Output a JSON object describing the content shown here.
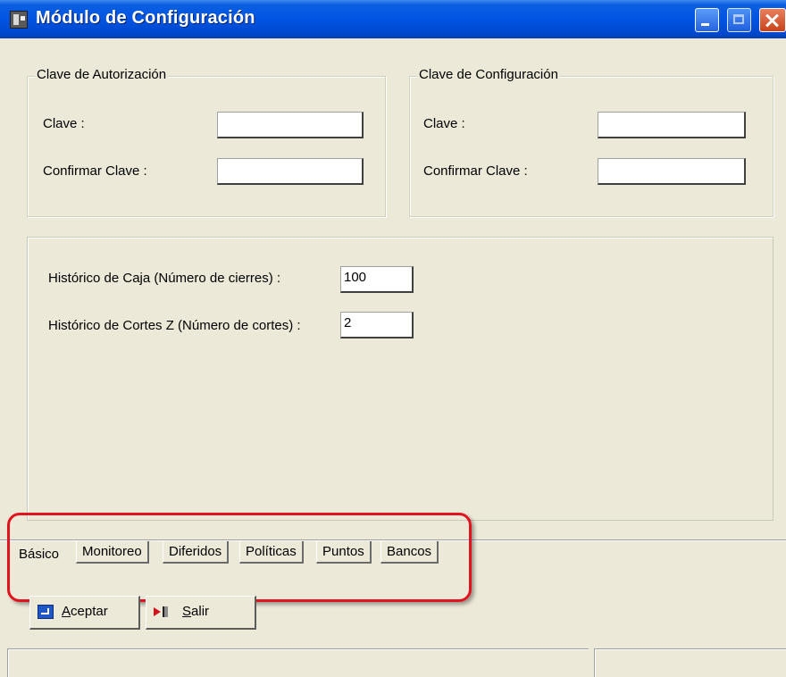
{
  "window": {
    "title": "Módulo de Configuración",
    "colors": {
      "title_bar": "#0054e3",
      "close_button": "#d44a24",
      "highlight": "#e0141e",
      "background": "#ece9d8"
    }
  },
  "authorization_group": {
    "legend": "Clave de Autorización",
    "key_label": "Clave :",
    "key_value": "",
    "confirm_label": "Confirmar Clave :",
    "confirm_value": ""
  },
  "configuration_group": {
    "legend": "Clave de Configuración",
    "key_label": "Clave :",
    "key_value": "",
    "confirm_label": "Confirmar Clave :",
    "confirm_value": ""
  },
  "history": {
    "cash_label": "Histórico de Caja (Número de cierres) :",
    "cash_value": "100",
    "z_cuts_label": "Histórico de Cortes Z (Número de cortes) :",
    "z_cuts_value": "2"
  },
  "tabs": [
    "Básico",
    "Monitoreo",
    "Diferidos",
    "Políticas",
    "Puntos",
    "Bancos"
  ],
  "buttons": {
    "accept": "Aceptar",
    "exit": "Salir"
  },
  "icons": [
    "app-icon",
    "minimize-icon",
    "maximize-icon",
    "close-icon",
    "accept-icon",
    "exit-icon"
  ]
}
